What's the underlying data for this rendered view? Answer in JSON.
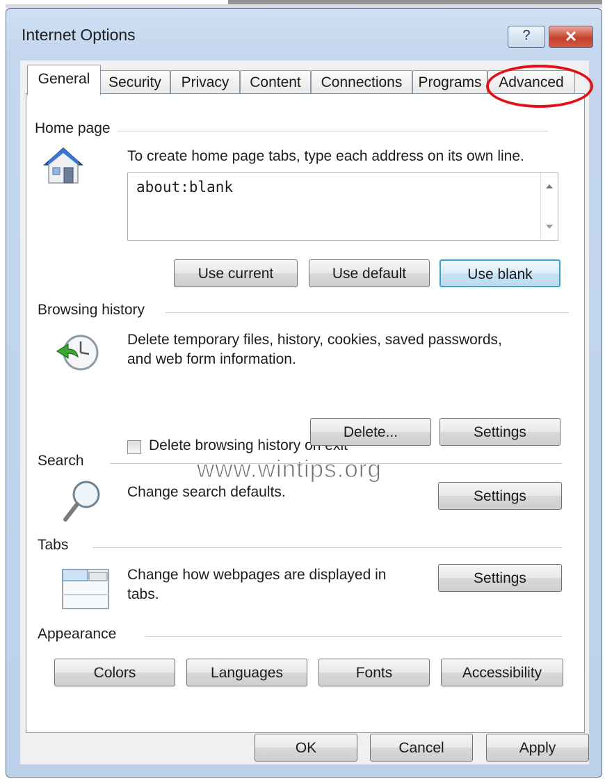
{
  "window": {
    "title": "Internet Options",
    "help_label": "?",
    "close_label": "✕"
  },
  "tabs": [
    "General",
    "Security",
    "Privacy",
    "Content",
    "Connections",
    "Programs",
    "Advanced"
  ],
  "active_tab": "General",
  "highlighted_tab": "Advanced",
  "accent_colors": {
    "highlight_circle": "#e3101a",
    "focus_border": "#3c9fd6"
  },
  "home_page": {
    "legend": "Home page",
    "instruction": "To create home page tabs, type each address on its own line.",
    "value": "about:blank",
    "buttons": {
      "use_current": "Use current",
      "use_default": "Use default",
      "use_blank": "Use blank"
    }
  },
  "browsing_history": {
    "legend": "Browsing history",
    "description_line1": "Delete temporary files, history, cookies, saved passwords,",
    "description_line2": "and web form information.",
    "checkbox_label": "Delete browsing history on exit",
    "checkbox_checked": false,
    "delete_label": "Delete...",
    "settings_label": "Settings"
  },
  "watermark": "www.wintips.org",
  "search": {
    "legend": "Search",
    "description": "Change search defaults.",
    "settings_label": "Settings"
  },
  "tabs_section": {
    "legend": "Tabs",
    "description_line1": "Change how webpages are displayed in",
    "description_line2": "tabs.",
    "settings_label": "Settings"
  },
  "appearance": {
    "legend": "Appearance",
    "buttons": {
      "colors": "Colors",
      "languages": "Languages",
      "fonts": "Fonts",
      "accessibility": "Accessibility"
    }
  },
  "footer": {
    "ok": "OK",
    "cancel": "Cancel",
    "apply": "Apply"
  },
  "icons": {
    "home_page": "house-icon",
    "browsing_history": "history-clock-icon",
    "search": "magnifier-icon",
    "tabs": "tabs-icon"
  }
}
